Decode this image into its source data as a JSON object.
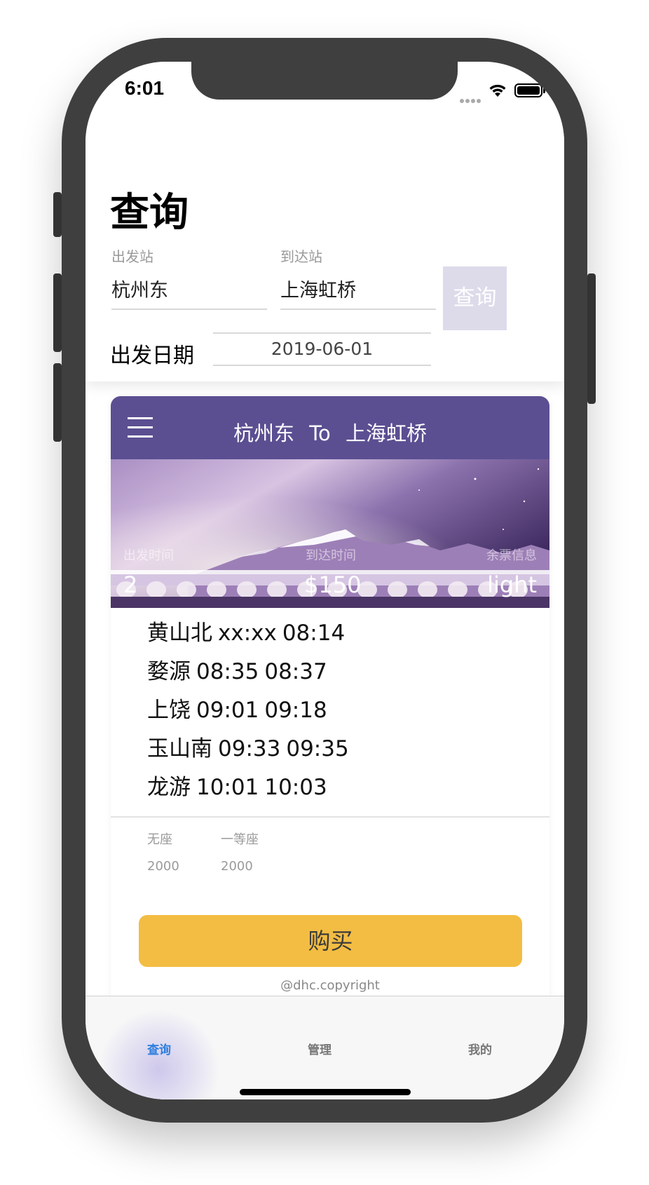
{
  "status_bar": {
    "time": "6:01",
    "wifi_icon": "wifi-icon",
    "battery_icon": "battery-icon"
  },
  "header": {
    "title": "查询"
  },
  "form": {
    "from_label": "出发站",
    "from_value": "杭州东",
    "to_label": "到达站",
    "to_value": "上海虹桥",
    "query_button": "查询",
    "date_label": "出发日期",
    "date_value": "2019-06-01"
  },
  "card": {
    "menu_icon": "menu-icon",
    "route_from": "杭州东",
    "route_to_word": "To",
    "route_to": "上海虹桥",
    "banner": {
      "depart_label": "出发时间",
      "arrive_label": "到达时间",
      "ticket_label": "余票信息",
      "depart_value": "2",
      "price": "$150",
      "ticket_value": "light"
    },
    "stops": [
      {
        "name": "黄山北",
        "arrive": "xx:xx",
        "depart": "08:14"
      },
      {
        "name": "婺源",
        "arrive": "08:35",
        "depart": "08:37"
      },
      {
        "name": "上饶",
        "arrive": "09:01",
        "depart": "09:18"
      },
      {
        "name": "玉山南",
        "arrive": "09:33",
        "depart": "09:35"
      },
      {
        "name": "龙游",
        "arrive": "10:01",
        "depart": "10:03"
      }
    ],
    "seats": [
      {
        "type": "无座",
        "count": "2000"
      },
      {
        "type": "一等座",
        "count": "2000"
      }
    ],
    "buy_button": "购买",
    "copyright": "@dhc.copyright"
  },
  "tabs": [
    {
      "label": "查询",
      "active": true
    },
    {
      "label": "管理",
      "active": false
    },
    {
      "label": "我的",
      "active": false
    }
  ],
  "colors": {
    "header_purple": "#5b4f92",
    "buy_yellow": "#f3bd43",
    "active_tab_blue": "#2d7fe0",
    "query_button_bg": "#dddbea"
  }
}
